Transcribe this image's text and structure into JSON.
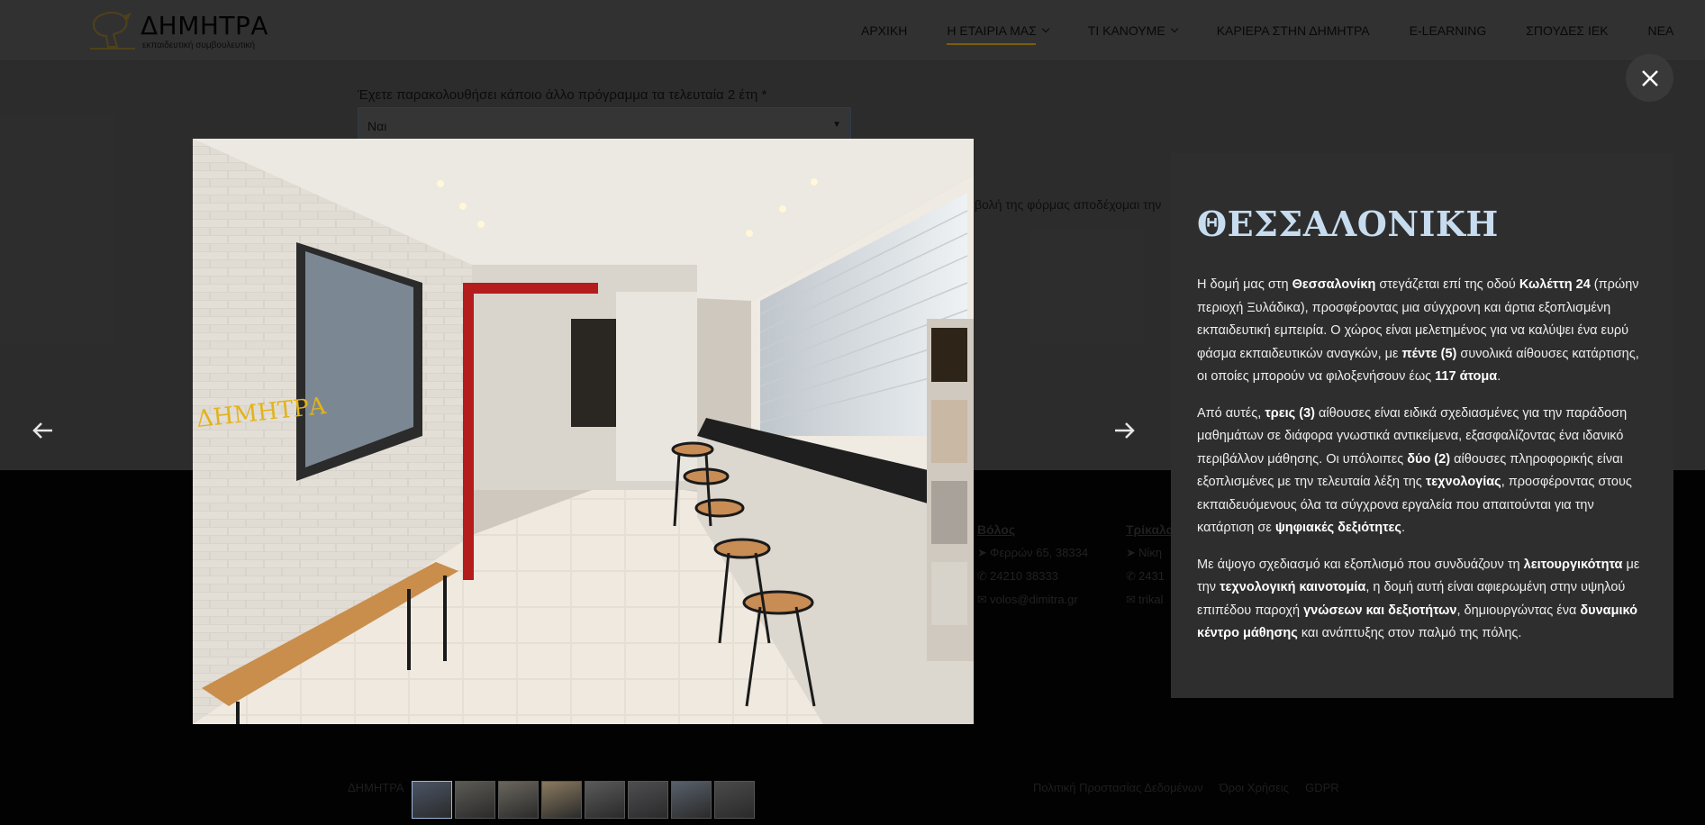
{
  "header": {
    "logo_text": "ΔΗΜΗΤΡΑ",
    "logo_sub": "εκπαιδευτική συμβουλευτική",
    "nav": [
      {
        "label": "ΑΡΧΙΚΗ",
        "dropdown": false,
        "active": false
      },
      {
        "label": "Η ΕΤΑΙΡΙΑ ΜΑΣ",
        "dropdown": true,
        "active": true
      },
      {
        "label": "ΤΙ ΚΑΝΟΥΜΕ",
        "dropdown": true,
        "active": false
      },
      {
        "label": "ΚΑΡΙΕΡΑ ΣΤΗΝ ΔΗΜΗΤΡΑ",
        "dropdown": false,
        "active": false
      },
      {
        "label": "E-LEARNING",
        "dropdown": false,
        "active": false
      },
      {
        "label": "ΣΠΟΥΔΕΣ ΙΕΚ",
        "dropdown": false,
        "active": false
      },
      {
        "label": "ΝΕΑ",
        "dropdown": false,
        "active": false
      }
    ]
  },
  "form": {
    "question": "Έχετε παρακολουθήσει κάποιο άλλο πρόγραμμα τα τελευταία 2 έτη *",
    "select_value": "Ναι",
    "consent_text": "βολή της φόρμας αποδέχομαι την"
  },
  "footer": {
    "offices": [
      {
        "city": "Βόλος",
        "address": "Φερρών 65, 38334",
        "phone": "24210 38333",
        "email": "volos@dimitra.gr"
      },
      {
        "city": "Τρίκαλα",
        "address": "Νίκη",
        "phone": "2431",
        "email": "trikal"
      }
    ],
    "copyright": "ΔΗΜΗΤΡΑ",
    "links": [
      "Πολιτική Προστασίας Δεδομένων",
      "Όροι Χρήσεις",
      "GDPR"
    ]
  },
  "lightbox": {
    "icons": {
      "close": "close-icon",
      "prev": "arrow-left-icon",
      "next": "arrow-right-icon"
    },
    "title": "ΘΕΣΣΑΛΟΝΙΚΗ",
    "paragraphs": [
      [
        {
          "t": "Η δομή μας στη "
        },
        {
          "t": "Θεσσαλονίκη",
          "b": true
        },
        {
          "t": " στεγάζεται επί της οδού "
        },
        {
          "t": "Κωλέττη 24",
          "b": true
        },
        {
          "t": " (πρώην περιοχή Ξυλάδικα), προσφέροντας μια σύγχρονη και άρτια εξοπλισμένη εκπαιδευτική εμπειρία. Ο χώρος είναι μελετημένος για να καλύψει ένα ευρύ φάσμα εκπαιδευτικών αναγκών, με "
        },
        {
          "t": "πέντε (5)",
          "b": true
        },
        {
          "t": " συνολικά αίθουσες κατάρτισης, οι οποίες μπορούν να φιλοξενήσουν έως "
        },
        {
          "t": "117 άτομα",
          "b": true
        },
        {
          "t": "."
        }
      ],
      [
        {
          "t": "Από αυτές, "
        },
        {
          "t": "τρεις (3)",
          "b": true
        },
        {
          "t": " αίθουσες είναι ειδικά σχεδιασμένες για την παράδοση μαθημάτων σε διάφορα γνωστικά αντικείμενα, εξασφαλίζοντας ένα ιδανικό περιβάλλον μάθησης. Οι υπόλοιπες "
        },
        {
          "t": "δύο (2)",
          "b": true
        },
        {
          "t": " αίθουσες πληροφορικής είναι εξοπλισμένες με την τελευταία λέξη της "
        },
        {
          "t": "τεχνολογίας",
          "b": true
        },
        {
          "t": ", προσφέροντας στους εκπαιδευόμενους όλα τα σύγχρονα εργαλεία που απαιτούνται για την κατάρτιση σε "
        },
        {
          "t": "ψηφιακές δεξιότητες",
          "b": true
        },
        {
          "t": "."
        }
      ],
      [
        {
          "t": "Με άψογο σχεδιασμό και εξοπλισμό που συνδυάζουν τη "
        },
        {
          "t": "λειτουργικότητα",
          "b": true
        },
        {
          "t": " με την "
        },
        {
          "t": "τεχνολογική καινοτομία",
          "b": true
        },
        {
          "t": ", η δομή αυτή είναι αφιερωμένη στην υψηλού επιπέδου παροχή "
        },
        {
          "t": "γνώσεων και δεξιοτήτων",
          "b": true
        },
        {
          "t": ", δημιουργώντας ένα "
        },
        {
          "t": "δυναμικό κέντρο μάθησης",
          "b": true
        },
        {
          "t": " και ανάπτυξης στον παλμό της πόλης."
        }
      ]
    ],
    "thumbnail_count": 8,
    "active_thumbnail": 1
  }
}
